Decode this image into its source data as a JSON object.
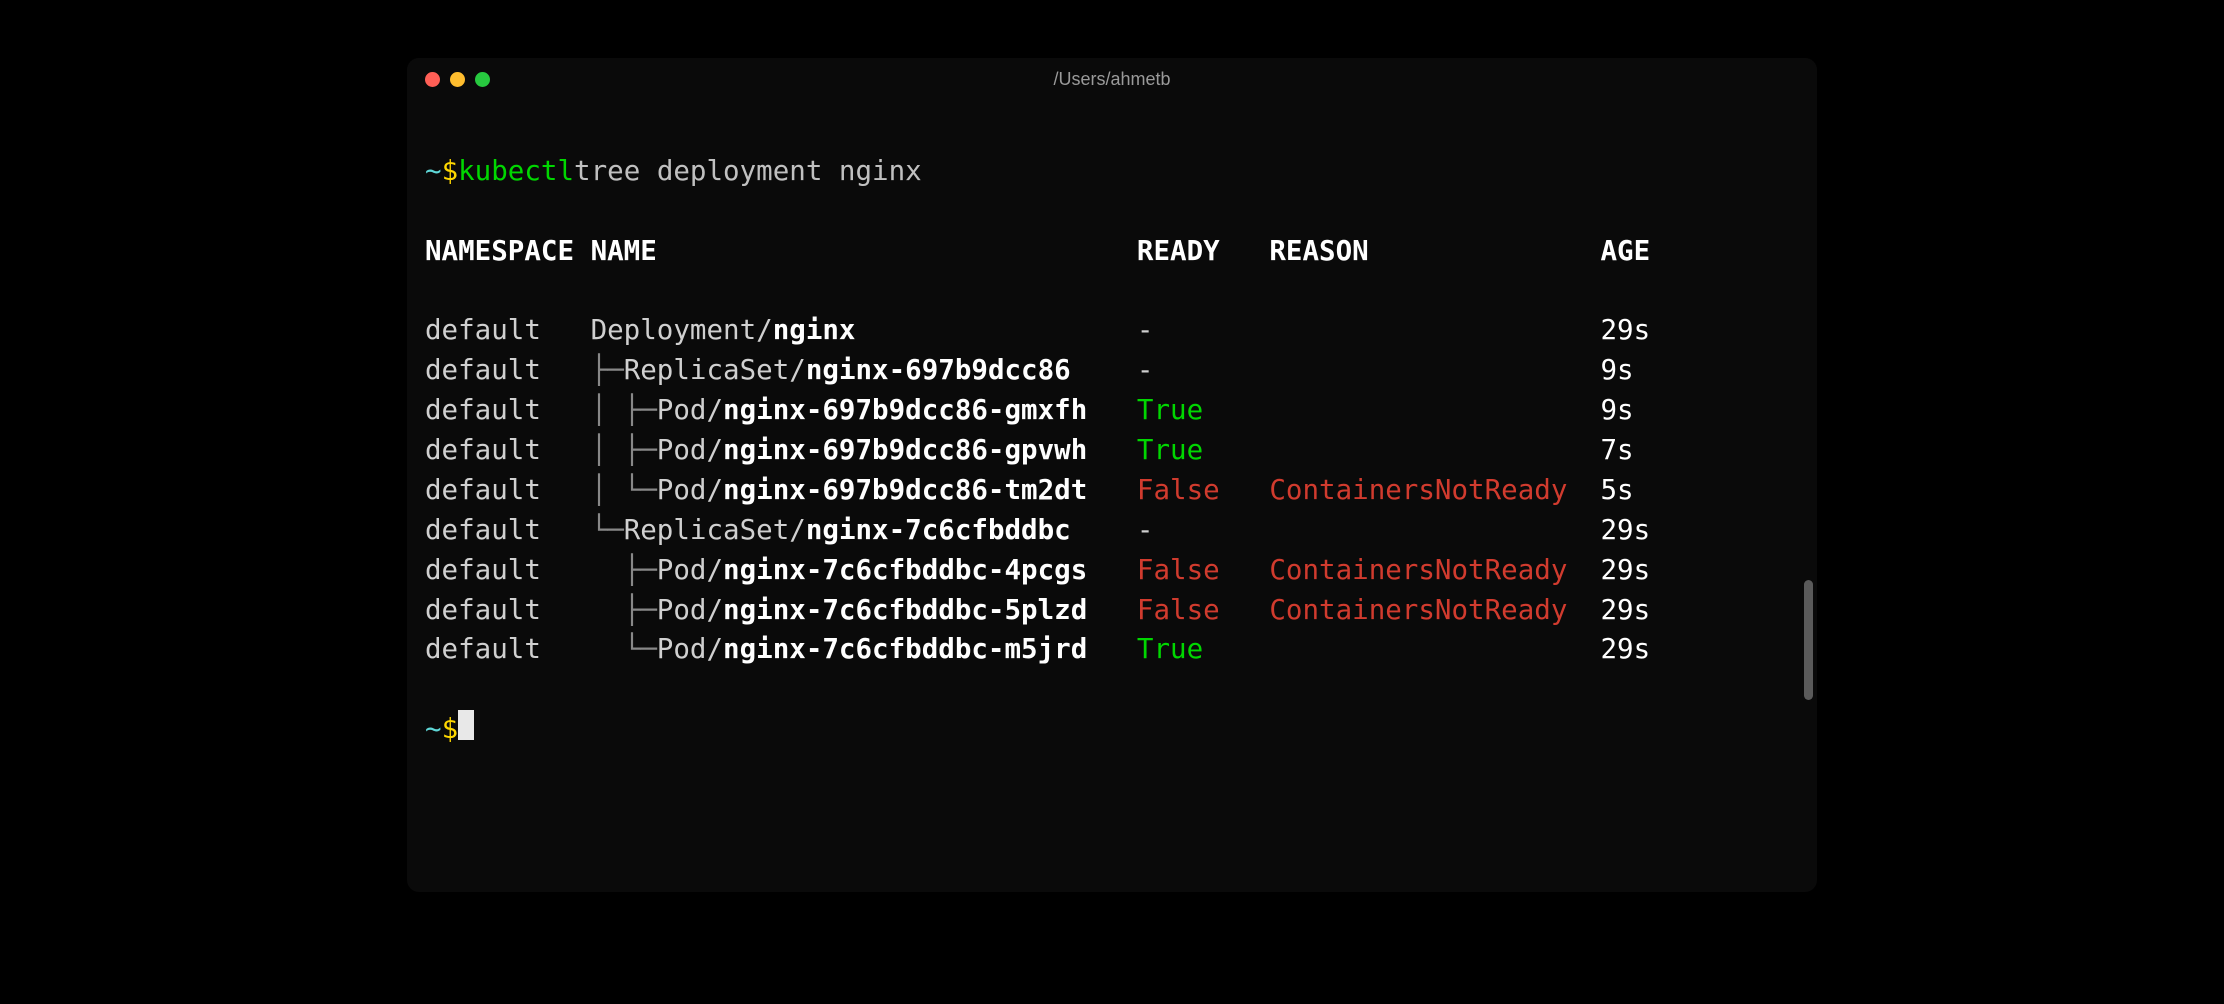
{
  "window": {
    "title": "/Users/ahmetb"
  },
  "prompt": {
    "tilde": "~",
    "dollar": "$",
    "command_part1": "kubectl",
    "command_part2": "tree deployment nginx"
  },
  "headers": {
    "namespace": "NAMESPACE",
    "name": "NAME",
    "ready": "READY",
    "reason": "REASON",
    "age": "AGE"
  },
  "rows": [
    {
      "ns": "default",
      "tree": "",
      "kind": "Deployment",
      "name": "nginx",
      "ready": "-",
      "ready_class": "ready-dash",
      "reason": "",
      "age": "29s"
    },
    {
      "ns": "default",
      "tree": "├─",
      "kind": "ReplicaSet",
      "name": "nginx-697b9dcc86",
      "ready": "-",
      "ready_class": "ready-dash",
      "reason": "",
      "age": "9s"
    },
    {
      "ns": "default",
      "tree": "│ ├─",
      "kind": "Pod",
      "name": "nginx-697b9dcc86-gmxfh",
      "ready": "True",
      "ready_class": "ready-true",
      "reason": "",
      "age": "9s"
    },
    {
      "ns": "default",
      "tree": "│ ├─",
      "kind": "Pod",
      "name": "nginx-697b9dcc86-gpvwh",
      "ready": "True",
      "ready_class": "ready-true",
      "reason": "",
      "age": "7s"
    },
    {
      "ns": "default",
      "tree": "│ └─",
      "kind": "Pod",
      "name": "nginx-697b9dcc86-tm2dt",
      "ready": "False",
      "ready_class": "ready-false",
      "reason": "ContainersNotReady",
      "age": "5s"
    },
    {
      "ns": "default",
      "tree": "└─",
      "kind": "ReplicaSet",
      "name": "nginx-7c6cfbddbc",
      "ready": "-",
      "ready_class": "ready-dash",
      "reason": "",
      "age": "29s"
    },
    {
      "ns": "default",
      "tree": "  ├─",
      "kind": "Pod",
      "name": "nginx-7c6cfbddbc-4pcgs",
      "ready": "False",
      "ready_class": "ready-false",
      "reason": "ContainersNotReady",
      "age": "29s"
    },
    {
      "ns": "default",
      "tree": "  ├─",
      "kind": "Pod",
      "name": "nginx-7c6cfbddbc-5plzd",
      "ready": "False",
      "ready_class": "ready-false",
      "reason": "ContainersNotReady",
      "age": "29s"
    },
    {
      "ns": "default",
      "tree": "  └─",
      "kind": "Pod",
      "name": "nginx-7c6cfbddbc-m5jrd",
      "ready": "True",
      "ready_class": "ready-true",
      "reason": "",
      "age": "29s"
    }
  ]
}
